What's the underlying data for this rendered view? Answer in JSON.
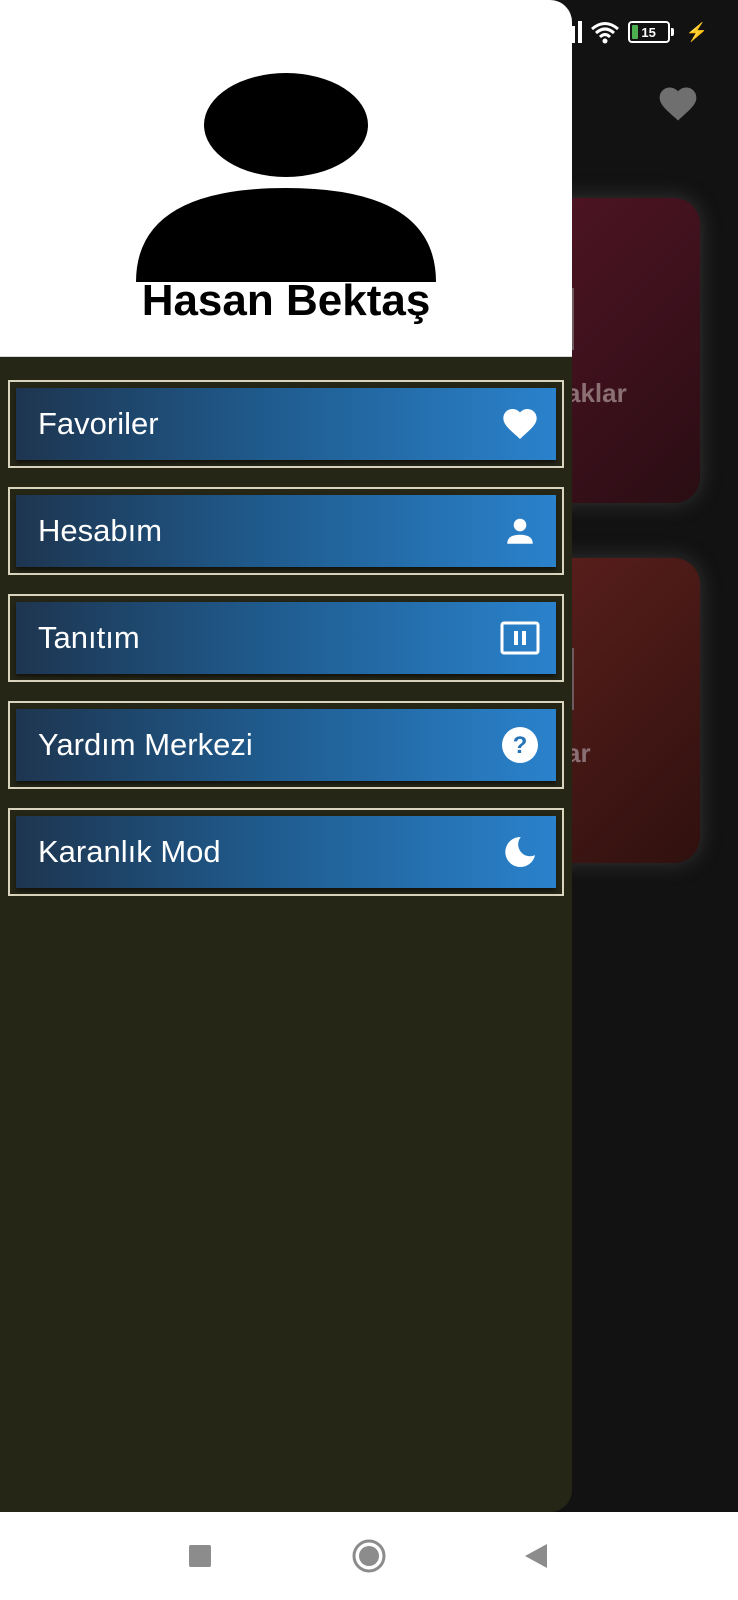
{
  "status_bar": {
    "battery_level": "15",
    "icons": [
      "signal-icon",
      "wifi-icon",
      "battery-icon",
      "charging-icon"
    ]
  },
  "background_app": {
    "card_1_label": "aklar",
    "card_2_label": "ar",
    "favorite_icon": "heart-icon"
  },
  "drawer": {
    "user_name": "Hasan Bektaş",
    "menu": [
      {
        "label": "Favoriler",
        "icon": "heart-icon"
      },
      {
        "label": "Hesabım",
        "icon": "person-icon"
      },
      {
        "label": "Tanıtım",
        "icon": "slideshow-icon"
      },
      {
        "label": "Yardım Merkezi",
        "icon": "help-icon"
      },
      {
        "label": "Karanlık Mod",
        "icon": "moon-icon"
      }
    ]
  },
  "nav_bar": {
    "icons": [
      "recents-square-icon",
      "home-circle-icon",
      "back-triangle-icon"
    ]
  },
  "colors": {
    "drawer_bg": "#262617",
    "menu_gradient_start": "#1e3550",
    "menu_gradient_end": "#2a82cc",
    "menu_border": "#d8d4bd"
  }
}
